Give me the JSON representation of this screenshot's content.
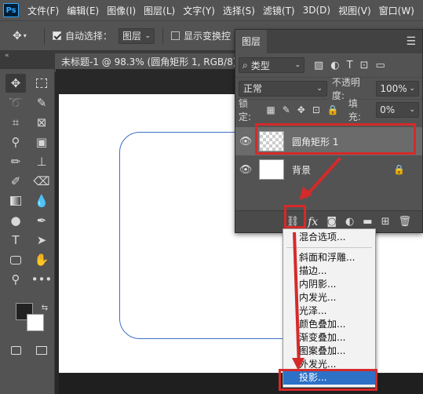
{
  "app_logo": "Ps",
  "menu": [
    "文件(F)",
    "编辑(E)",
    "图像(I)",
    "图层(L)",
    "文字(Y)",
    "选择(S)",
    "滤镜(T)",
    "3D(D)",
    "视图(V)",
    "窗口(W)"
  ],
  "options_bar": {
    "auto_select_label": "自动选择：",
    "auto_select_checked": true,
    "auto_select_target": "图层",
    "show_transform_label": "显示变换控",
    "show_transform_checked": false
  },
  "document_tab": "未标题-1 @ 98.3% (圆角矩形 1, RGB/8) *",
  "layers_panel": {
    "title": "图层",
    "filter_type": "类型",
    "blend_mode": "正常",
    "opacity_label": "不透明度:",
    "opacity_value": "100%",
    "lock_label": "锁定:",
    "fill_label": "填充:",
    "fill_value": "0%",
    "layers": [
      {
        "name": "圆角矩形 1",
        "selected": true,
        "visible": true
      },
      {
        "name": "背景",
        "selected": false,
        "visible": true,
        "locked": true
      }
    ],
    "footer_fx_label": "fx"
  },
  "fx_menu": {
    "items": [
      "混合选项...",
      "斜面和浮雕...",
      "描边...",
      "内阴影...",
      "内发光...",
      "光泽...",
      "颜色叠加...",
      "渐变叠加...",
      "图案叠加...",
      "外发光...",
      "投影..."
    ],
    "highlighted": "投影..."
  },
  "colors": {
    "ui_panel": "#535353",
    "canvas_bg": "#282828",
    "shape_stroke": "#3d6ec6",
    "highlight": "#2d71c7",
    "annotation": "#d42a2a"
  }
}
